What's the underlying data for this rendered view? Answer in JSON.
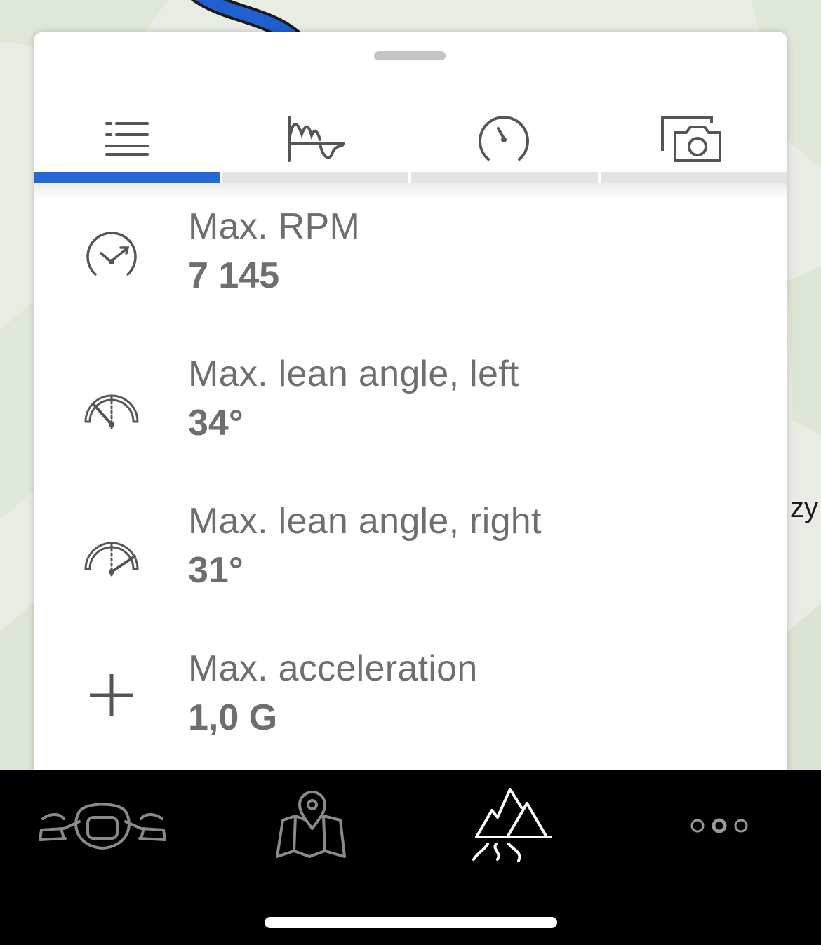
{
  "map": {
    "label": "zy",
    "route_color": "#1f5fd0"
  },
  "tabs": [
    {
      "icon": "list-icon",
      "active": true
    },
    {
      "icon": "graph-icon",
      "active": false
    },
    {
      "icon": "speedometer-icon",
      "active": false
    },
    {
      "icon": "photo-camera-icon",
      "active": false
    }
  ],
  "accent_color": "#2368d4",
  "stats": [
    {
      "icon": "rpm-gauge-icon",
      "label": "Max. RPM",
      "value": "7 145"
    },
    {
      "icon": "lean-left-gauge-icon",
      "label": "Max. lean angle, left",
      "value": "34°"
    },
    {
      "icon": "lean-right-gauge-icon",
      "label": "Max. lean angle, right",
      "value": "31°"
    },
    {
      "icon": "acceleration-plus-icon",
      "label": "Max. acceleration",
      "value": "1,0 G"
    }
  ],
  "bottom_nav": [
    {
      "icon": "motorcycle-handlebar-icon",
      "active": false
    },
    {
      "icon": "map-pin-icon",
      "active": false
    },
    {
      "icon": "mountain-road-icon",
      "active": true
    },
    {
      "icon": "more-dots-icon",
      "active": false
    }
  ]
}
